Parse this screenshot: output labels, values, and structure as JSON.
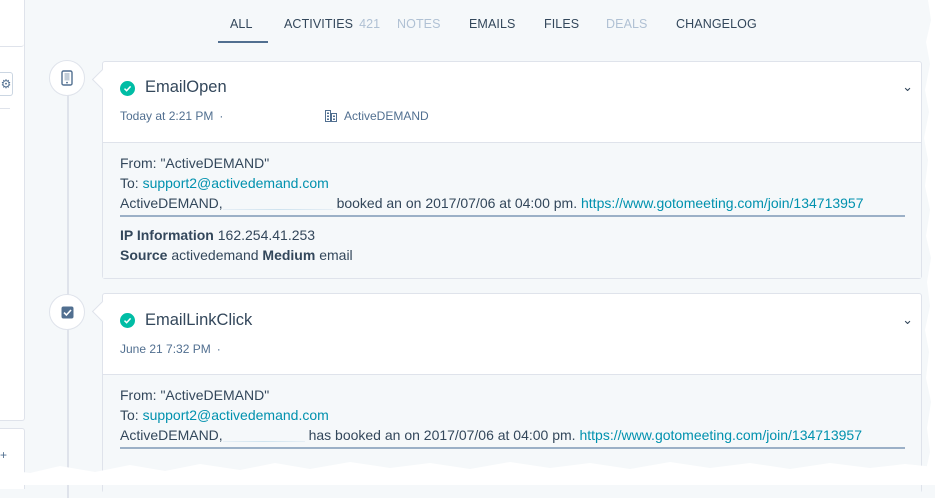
{
  "tabs": [
    {
      "label": "ALL",
      "active": true,
      "disabled": false
    },
    {
      "label": "ACTIVITIES",
      "count": "421",
      "disabled": false
    },
    {
      "label": "NOTES",
      "disabled": true
    },
    {
      "label": "EMAILS",
      "disabled": false
    },
    {
      "label": "FILES",
      "disabled": false
    },
    {
      "label": "DEALS",
      "disabled": true
    },
    {
      "label": "CHANGELOG",
      "disabled": false
    }
  ],
  "events": [
    {
      "node_icon": "mobile-phone-icon",
      "title": "EmailOpen",
      "time": "Today at 2:21 PM",
      "separator": "·",
      "source": "ActiveDEMAND",
      "body": {
        "from": "From: \"ActiveDEMAND\"",
        "to_label": "To: ",
        "to_email": "support2@activedemand.com",
        "line_prefix": "ActiveDEMAND,",
        "line_mid": "booked an on 2017/07/06 at 04:00 pm.",
        "link": "https://www.gotomeeting.com/join/134713957",
        "ip_label": "IP Information",
        "ip_value": "162.254.41.253",
        "source_label": "Source",
        "source_value": "activedemand",
        "medium_label": "Medium",
        "medium_value": "email"
      }
    },
    {
      "node_icon": "checkbox-icon",
      "title": "EmailLinkClick",
      "time": "June 21 7:32 PM",
      "separator": "·",
      "body": {
        "from": "From: \"ActiveDEMAND\"",
        "to_label": "To: ",
        "to_email": "support2@activedemand.com",
        "line_prefix": "ActiveDEMAND,",
        "line_mid": "has booked an on 2017/07/06 at 04:00 pm.",
        "link": "https://www.gotomeeting.com/join/134713957"
      }
    }
  ],
  "colors": {
    "success": "#00bda5",
    "link": "#0091ae",
    "text": "#33475b",
    "muted": "#516f90",
    "disabled": "#b0c1d4"
  }
}
